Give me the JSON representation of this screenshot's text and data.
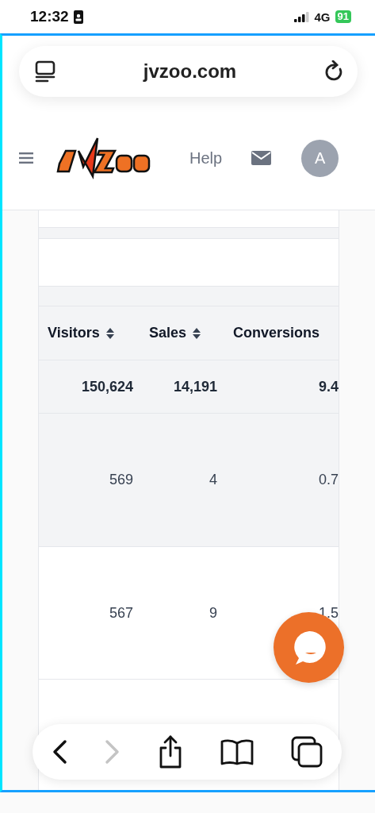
{
  "status_bar": {
    "time": "12:32",
    "network": "4G",
    "battery": "91"
  },
  "browser": {
    "url": "jvzoo.com"
  },
  "nav": {
    "help": "Help",
    "avatar": "A"
  },
  "table": {
    "columns": [
      {
        "label": "Visitors",
        "sortable": true
      },
      {
        "label": "Sales",
        "sortable": true
      },
      {
        "label": "Conversions",
        "sortable": false
      }
    ],
    "rows": [
      {
        "kind": "total",
        "cells": [
          "150,624",
          "14,191",
          "9.4"
        ]
      },
      {
        "kind": "shaded",
        "cells": [
          "569",
          "4",
          "0.7"
        ]
      },
      {
        "kind": "plain",
        "cells": [
          "567",
          "9",
          "1.5"
        ]
      },
      {
        "kind": "plain",
        "cells": []
      }
    ]
  }
}
